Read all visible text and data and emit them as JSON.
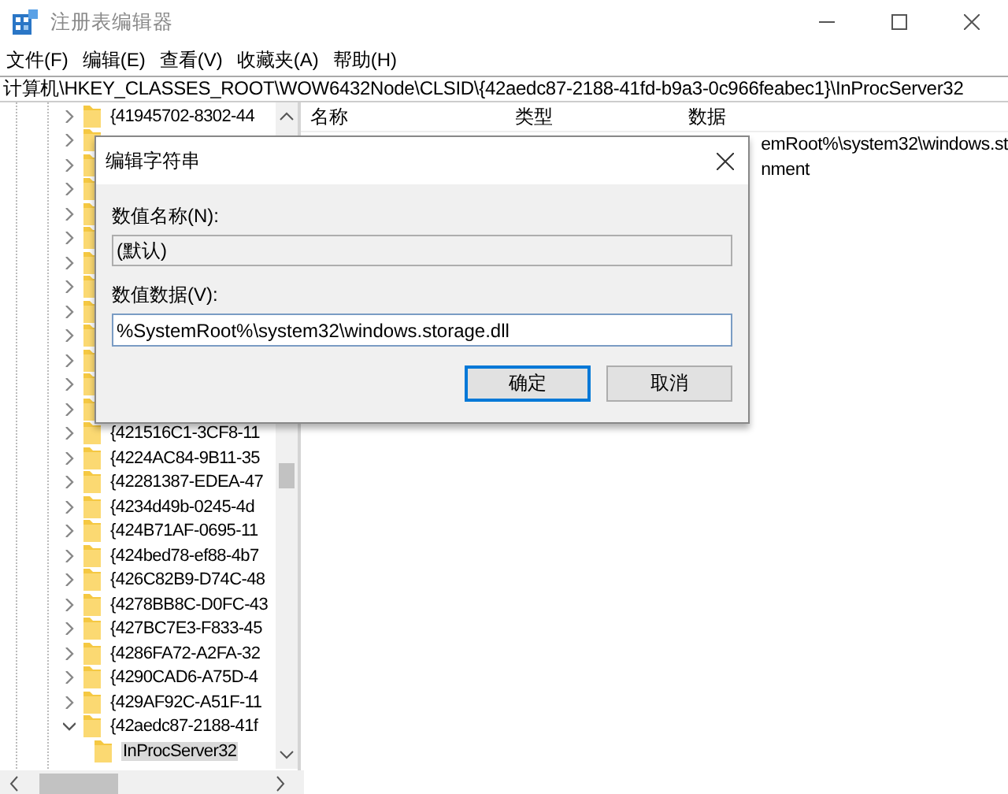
{
  "window": {
    "title": "注册表编辑器"
  },
  "menu": [
    "文件(F)",
    "编辑(E)",
    "查看(V)",
    "收藏夹(A)",
    "帮助(H)"
  ],
  "address": "计算机\\HKEY_CLASSES_ROOT\\WOW6432Node\\CLSID\\{42aedc87-2188-41fd-b9a3-0c966feabec1}\\InProcServer32",
  "tree": {
    "items": [
      {
        "kind": "folder",
        "label": "{41945702-8302-44",
        "expanded": false
      },
      {
        "kind": "covered",
        "expanded": false
      },
      {
        "kind": "covered",
        "expanded": false
      },
      {
        "kind": "covered",
        "expanded": false
      },
      {
        "kind": "covered",
        "expanded": false
      },
      {
        "kind": "covered",
        "expanded": false
      },
      {
        "kind": "covered",
        "expanded": false
      },
      {
        "kind": "covered",
        "expanded": false
      },
      {
        "kind": "covered",
        "expanded": false
      },
      {
        "kind": "covered",
        "expanded": false
      },
      {
        "kind": "covered",
        "expanded": false
      },
      {
        "kind": "covered",
        "expanded": false
      },
      {
        "kind": "covered",
        "expanded": false
      },
      {
        "kind": "folder",
        "label": "{421516C1-3CF8-11",
        "expanded": false
      },
      {
        "kind": "folder",
        "label": "{4224AC84-9B11-35",
        "expanded": false
      },
      {
        "kind": "folder",
        "label": "{42281387-EDEA-47",
        "expanded": false
      },
      {
        "kind": "folder",
        "label": "{4234d49b-0245-4d",
        "expanded": false
      },
      {
        "kind": "folder",
        "label": "{424B71AF-0695-11",
        "expanded": false
      },
      {
        "kind": "folder",
        "label": "{424bed78-ef88-4b7",
        "expanded": false
      },
      {
        "kind": "folder",
        "label": "{426C82B9-D74C-48",
        "expanded": false
      },
      {
        "kind": "folder",
        "label": "{4278BB8C-D0FC-43",
        "expanded": false
      },
      {
        "kind": "folder",
        "label": "{427BC7E3-F833-45",
        "expanded": false
      },
      {
        "kind": "folder",
        "label": "{4286FA72-A2FA-32",
        "expanded": false
      },
      {
        "kind": "folder",
        "label": "{4290CAD6-A75D-4",
        "expanded": false
      },
      {
        "kind": "folder",
        "label": "{429AF92C-A51F-11",
        "expanded": false
      },
      {
        "kind": "folder",
        "label": "{42aedc87-2188-41f",
        "expanded": true,
        "children": [
          {
            "label": "InProcServer32",
            "selected": true
          }
        ]
      }
    ]
  },
  "values": {
    "columns": [
      "名称",
      "类型",
      "数据"
    ],
    "rows": [
      {
        "data": "emRoot%\\system32\\windows.st"
      },
      {
        "data": "nment"
      }
    ]
  },
  "dialog": {
    "title": "编辑字符串",
    "name_label": "数值名称(N):",
    "name_value": "(默认)",
    "data_label": "数值数据(V):",
    "data_value": "%SystemRoot%\\system32\\windows.storage.dll",
    "buttons": [
      {
        "label": "确定",
        "default": true
      },
      {
        "label": "取消",
        "default": false
      }
    ]
  }
}
